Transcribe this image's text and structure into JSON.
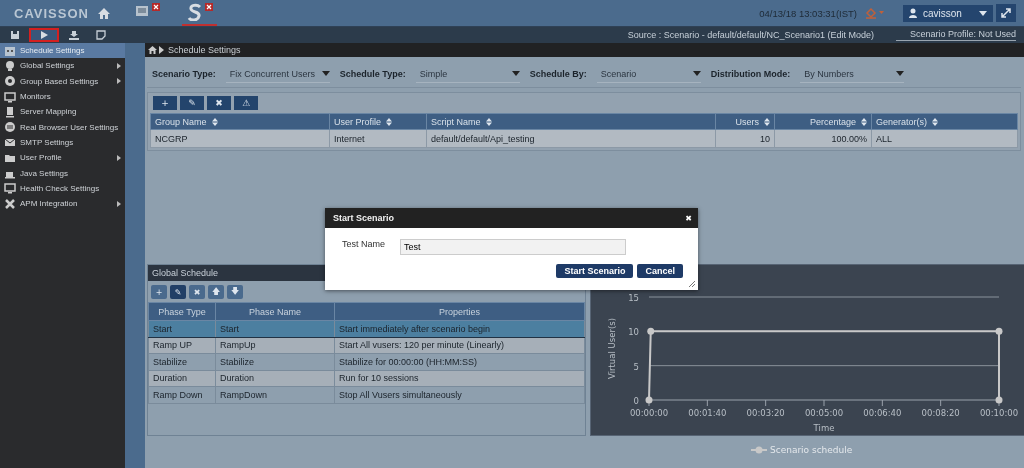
{
  "header": {
    "logo": "CAVISSON",
    "tabs": [
      {
        "kind": "monitor",
        "selected": false
      },
      {
        "kind": "scenario",
        "selected": true
      }
    ],
    "datetime": "04/13/18 13:03:31(IST)",
    "user": "cavisson"
  },
  "toolbar": {
    "buttons": [
      {
        "kind": "save",
        "selected": false
      },
      {
        "kind": "play",
        "selected": true
      },
      {
        "kind": "download",
        "selected": false
      },
      {
        "kind": "note",
        "selected": false
      }
    ],
    "source": "Source : Scenario - default/default/NC_Scenario1 (Edit Mode)",
    "profile": "Scenario Profile: Not Used"
  },
  "sidebar": {
    "items": [
      {
        "label": "Schedule Settings",
        "submenu": false,
        "selected": true
      },
      {
        "label": "Global Settings",
        "submenu": true,
        "selected": false
      },
      {
        "label": "Group Based Settings",
        "submenu": true,
        "selected": false
      },
      {
        "label": "Monitors",
        "submenu": false,
        "selected": false
      },
      {
        "label": "Server Mapping",
        "submenu": false,
        "selected": false
      },
      {
        "label": "Real Browser User Settings",
        "submenu": false,
        "selected": false
      },
      {
        "label": "SMTP Settings",
        "submenu": false,
        "selected": false
      },
      {
        "label": "User Profile",
        "submenu": true,
        "selected": false
      },
      {
        "label": "Java Settings",
        "submenu": false,
        "selected": false
      },
      {
        "label": "Health Check Settings",
        "submenu": false,
        "selected": false
      },
      {
        "label": "APM Integration",
        "submenu": true,
        "selected": false
      }
    ]
  },
  "breadcrumb": "Schedule Settings",
  "filters": [
    {
      "label": "Scenario Type:",
      "value": "Fix Concurrent Users"
    },
    {
      "label": "Schedule Type:",
      "value": "Simple"
    },
    {
      "label": "Schedule By:",
      "value": "Scenario"
    },
    {
      "label": "Distribution Mode:",
      "value": "By Numbers"
    }
  ],
  "groups_table": {
    "actions": [
      "+",
      "✎",
      "✖",
      "⚠"
    ],
    "columns": [
      "Group Name",
      "User Profile",
      "Script Name",
      "Users",
      "Percentage",
      "Generator(s)"
    ],
    "rows": [
      [
        "NCGRP",
        "Internet",
        "default/default/Api_testing",
        "10",
        "100.00%",
        "ALL"
      ]
    ]
  },
  "global_schedule": {
    "title": "Global Schedule",
    "actions": [
      {
        "glyph": "+",
        "selected": false
      },
      {
        "glyph": "✎",
        "selected": true
      },
      {
        "glyph": "✖",
        "selected": false
      },
      {
        "glyph": "🡅",
        "selected": false
      },
      {
        "glyph": "🡇",
        "selected": false
      }
    ],
    "columns": [
      "Phase Type",
      "Phase Name",
      "Properties"
    ],
    "rows": [
      {
        "cells": [
          "Start",
          "Start",
          "Start immediately after scenario begin"
        ],
        "selected": true
      },
      {
        "cells": [
          "Ramp UP",
          "RampUp",
          "Start All vusers: 120 per minute (Linearly)"
        ],
        "selected": false
      },
      {
        "cells": [
          "Stabilize",
          "Stabilize",
          "Stabilize for 00:00:00 (HH:MM:SS)"
        ],
        "selected": false
      },
      {
        "cells": [
          "Duration",
          "Duration",
          "Run for 10 sessions"
        ],
        "selected": false
      },
      {
        "cells": [
          "Ramp Down",
          "RampDown",
          "Stop All Vusers simultaneously"
        ],
        "selected": false
      }
    ]
  },
  "schedule_chart": {
    "chart_data": {
      "type": "line",
      "xlabel": "Time",
      "ylabel": "Virtual User(s)",
      "x": [
        0,
        3,
        600,
        600
      ],
      "series": [
        {
          "name": "Scenario schedule",
          "color": "#c8c8c8",
          "marker": "circle",
          "values": [
            0,
            10,
            10,
            0
          ]
        }
      ],
      "xlim": [
        0,
        600
      ],
      "ylim": [
        0,
        15
      ],
      "xticks": [
        {
          "value": 0,
          "label": "00:00:00"
        },
        {
          "value": 100,
          "label": "00:01:40"
        },
        {
          "value": 200,
          "label": "00:03:20"
        },
        {
          "value": 300,
          "label": "00:05:00"
        },
        {
          "value": 400,
          "label": "00:06:40"
        },
        {
          "value": 500,
          "label": "00:08:20"
        },
        {
          "value": 600,
          "label": "00:10:00"
        }
      ],
      "yticks": [
        0,
        5,
        10,
        15
      ]
    }
  },
  "dialog": {
    "title": "Start Scenario",
    "close": "✖",
    "field_label": "Test Name",
    "field_value": "Test",
    "buttons": [
      "Start Scenario",
      "Cancel"
    ]
  }
}
